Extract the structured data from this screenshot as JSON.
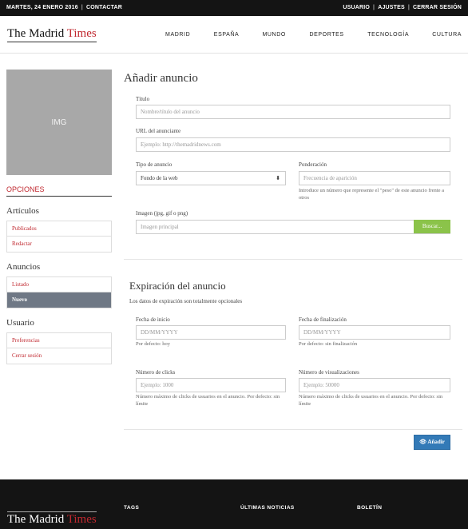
{
  "topbar": {
    "date": "MARTES, 24 ENERO 2016",
    "contact": "CONTACTAR",
    "user": "USUARIO",
    "settings": "AJUSTES",
    "logout": "CERRAR SESIÓN"
  },
  "logo": {
    "part1": "The Madrid ",
    "part2": "Times"
  },
  "nav": [
    "MADRID",
    "ESPAÑA",
    "MUNDO",
    "DEPORTES",
    "TECNOLOGÍA",
    "CULTURA"
  ],
  "sidebar": {
    "img_label": "IMG",
    "options_title": "OPCIONES",
    "sections": [
      {
        "title": "Artículos",
        "items": [
          "Publicados",
          "Redactar"
        ]
      },
      {
        "title": "Anuncios",
        "items": [
          "Listado",
          "Nuevo"
        ]
      },
      {
        "title": "Usuario",
        "items": [
          "Preferencias",
          "Cerrar sesión"
        ]
      }
    ]
  },
  "form": {
    "title": "Añadir anuncio",
    "titulo_label": "Título",
    "titulo_placeholder": "Nombre/título del anuncio",
    "url_label": "URL del anunciante",
    "url_placeholder": "Ejemplo: http://themadridnews.com",
    "tipo_label": "Tipo de anuncio",
    "tipo_value": "Fondo de la web",
    "ponderacion_label": "Ponderación",
    "ponderacion_placeholder": "Frecuencia de aparición",
    "ponderacion_help": "Introduce un número que represente el \"peso\" de este anuncio frente a otros",
    "imagen_label": "Imagen (jpg, gif o png)",
    "imagen_placeholder": "Imagen principal",
    "buscar_label": "Buscar...",
    "exp_title": "Expiración del anuncio",
    "exp_subtitle": "Los datos de expiración son totalmente opcionales",
    "inicio_label": "Fecha de inicio",
    "inicio_placeholder": "DD/MM/YYYY",
    "inicio_help": "Por defecto: hoy",
    "fin_label": "Fecha de finalización",
    "fin_placeholder": "DD/MM/YYYY",
    "fin_help": "Por defecto: sin finalización",
    "clicks_label": "Número de clicks",
    "clicks_placeholder": "Ejemplo: 1000",
    "clicks_help": "Número máximo de clicks de usuarios en el anuncio. Por defecto: sin límite",
    "vis_label": "Número de visualizaciones",
    "vis_placeholder": "Ejemplo: 50000",
    "vis_help": "Número máximo de clicks de usuarios en el anuncio. Por defecto: sin límite",
    "add_label": "Añadir"
  },
  "footer": {
    "tags": "TAGS",
    "news": "ÚLTIMAS NOTICIAS",
    "newsletter": "BOLETÍN"
  }
}
